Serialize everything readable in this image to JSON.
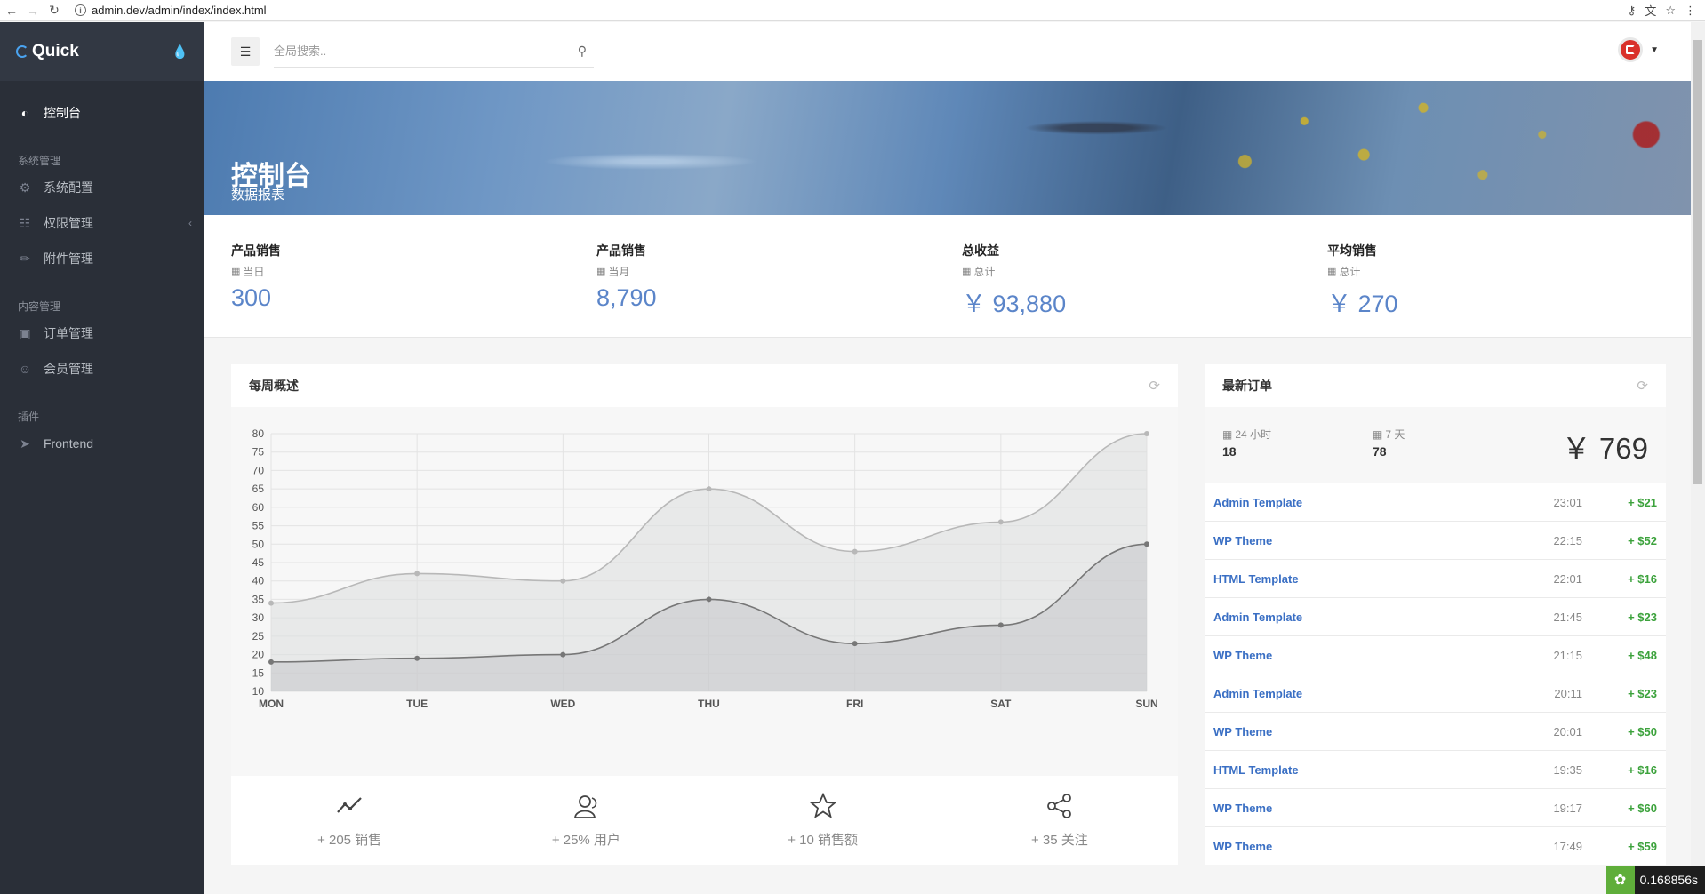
{
  "browser": {
    "url": "admin.dev/admin/index/index.html"
  },
  "sidebar": {
    "brand": "Quick",
    "items": [
      {
        "label": "控制台",
        "icon": "dashboard-icon"
      },
      {
        "label": "系统配置",
        "icon": "gear-icon"
      },
      {
        "label": "权限管理",
        "icon": "sitemap-icon"
      },
      {
        "label": "附件管理",
        "icon": "paperclip-icon"
      },
      {
        "label": "订单管理",
        "icon": "shopping-bag-icon"
      },
      {
        "label": "会员管理",
        "icon": "user-icon"
      },
      {
        "label": "Frontend",
        "icon": "rocket-icon"
      }
    ],
    "groups": [
      "系统管理",
      "内容管理",
      "插件"
    ]
  },
  "header": {
    "search_placeholder": "全局搜索.."
  },
  "hero": {
    "title": "控制台",
    "subtitle": "数据报表"
  },
  "stats": [
    {
      "label": "产品销售",
      "sub": "当日",
      "value": "300"
    },
    {
      "label": "产品销售",
      "sub": "当月",
      "value": "8,790"
    },
    {
      "label": "总收益",
      "sub": "总计",
      "value": "￥ 93,880"
    },
    {
      "label": "平均销售",
      "sub": "总计",
      "value": "￥ 270"
    }
  ],
  "weekly": {
    "title": "每周概述",
    "metrics": [
      {
        "icon": "trend-line-icon",
        "text": "+ 205 销售"
      },
      {
        "icon": "users-icon",
        "text": "+ 25% 用户"
      },
      {
        "icon": "star-icon",
        "text": "+ 10 销售额"
      },
      {
        "icon": "share-icon",
        "text": "+ 35 关注"
      }
    ]
  },
  "chart_data": {
    "type": "area",
    "categories": [
      "MON",
      "TUE",
      "WED",
      "THU",
      "FRI",
      "SAT",
      "SUN"
    ],
    "series": [
      {
        "values": [
          34,
          42,
          40,
          65,
          48,
          56,
          80
        ],
        "color": "#b8b8b8"
      },
      {
        "values": [
          18,
          19,
          20,
          35,
          23,
          28,
          50
        ],
        "color": "#777777"
      }
    ],
    "yticks": [
      10,
      15,
      20,
      25,
      30,
      35,
      40,
      45,
      50,
      55,
      60,
      65,
      70,
      75,
      80
    ],
    "ylim": [
      10,
      80
    ],
    "grid": true
  },
  "orders": {
    "title": "最新订单",
    "summary": {
      "day_label": "24 小时",
      "day_value": "18",
      "week_label": "7 天",
      "week_value": "78",
      "total": "￥ 769"
    },
    "rows": [
      {
        "name": "Admin Template",
        "time": "23:01",
        "amount": "+ $21"
      },
      {
        "name": "WP Theme",
        "time": "22:15",
        "amount": "+ $52"
      },
      {
        "name": "HTML Template",
        "time": "22:01",
        "amount": "+ $16"
      },
      {
        "name": "Admin Template",
        "time": "21:45",
        "amount": "+ $23"
      },
      {
        "name": "WP Theme",
        "time": "21:15",
        "amount": "+ $48"
      },
      {
        "name": "Admin Template",
        "time": "20:11",
        "amount": "+ $23"
      },
      {
        "name": "WP Theme",
        "time": "20:01",
        "amount": "+ $50"
      },
      {
        "name": "HTML Template",
        "time": "19:35",
        "amount": "+ $16"
      },
      {
        "name": "WP Theme",
        "time": "19:17",
        "amount": "+ $60"
      },
      {
        "name": "WP Theme",
        "time": "17:49",
        "amount": "+ $59"
      }
    ]
  },
  "debug": {
    "time": "0.168856s"
  }
}
